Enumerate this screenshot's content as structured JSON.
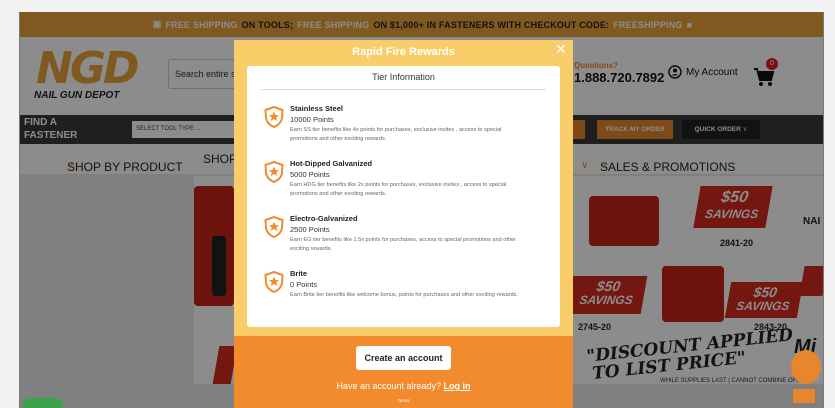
{
  "promo": {
    "part1": "FREE SHIPPING",
    "part2": "ON TOOLS;",
    "part3": "FREE SHIPPING",
    "part4": "ON $1,000+ IN FASTENERS WITH CHECKOUT CODE:",
    "code": "FREESHIPPING"
  },
  "header": {
    "logo_big": "NGD",
    "logo_sub": "NAIL GUN DEPOT",
    "search_placeholder": "Search entire st",
    "questions_label": "Questions?",
    "phone": "1.888.720.7892",
    "account_label": "My Account",
    "cart_count": "0"
  },
  "nav": {
    "find_fastener": "FIND A FASTENER",
    "select_tool": "SELECT TOOL TYPE ...",
    "track_order": "TRACK MY ORDER",
    "quick_order": "QUICK ORDER"
  },
  "menu": {
    "shop_by_product": "SHOP BY PRODUCT",
    "shop_partial": "SHOP",
    "sales_promotions": "SALES & PROMOTIONS"
  },
  "hero": {
    "tag_top": "$50\nSAVINGS",
    "tag_top_price": "$50",
    "tag_top_word": "SAVINGS",
    "model_top": "2841-20",
    "tag_mid_price": "$50",
    "tag_mid_word": "SAVINGS",
    "tag_right_price": "$50",
    "tag_right_word": "SAVINGS",
    "model_left": "2745-20",
    "model_right": "2843-20",
    "discount_line1": "\"DISCOUNT APPLIED",
    "discount_line2": "TO LIST PRICE\"",
    "fine_print": "WHILE SUPPLIES LAST | CANNOT COMBINE OFFERS",
    "brand_partial_1": "NAI",
    "brand_partial_2": "Mi"
  },
  "modal": {
    "title": "Rapid Fire Rewards",
    "close": "✕",
    "card_title": "Tier Information",
    "tiers": [
      {
        "name": "Stainless Steel",
        "points": "10000 Points",
        "desc": "Earn SS tier benefits like 4x points for purchases, exclusive invites , access to special promotions and other exciting rewards."
      },
      {
        "name": "Hot-Dipped Galvanized",
        "points": "5000 Points",
        "desc": "Earn HDG tier benefits like 2x points for purchases, exclusive invites , access to special promotions and other exciting rewards."
      },
      {
        "name": "Electro-Galvanized",
        "points": "2500 Points",
        "desc": "Earn EG tier benefits like 1.5x points for purchases, access to special promotions and other exciting rewards."
      },
      {
        "name": "Brite",
        "points": "0 Points",
        "desc": "Earn Brite tier benefits like welcome bonus, points for purchases and other exciting rewards."
      }
    ],
    "create_account": "Create an account",
    "have_account": "Have an account already?",
    "login": "Log in",
    "terms": "Terms"
  },
  "colors": {
    "brand_orange": "#e8862e",
    "promo_bar": "#e8a33a",
    "modal_yellow": "#f9cd6a",
    "modal_orange": "#f28a2e"
  }
}
